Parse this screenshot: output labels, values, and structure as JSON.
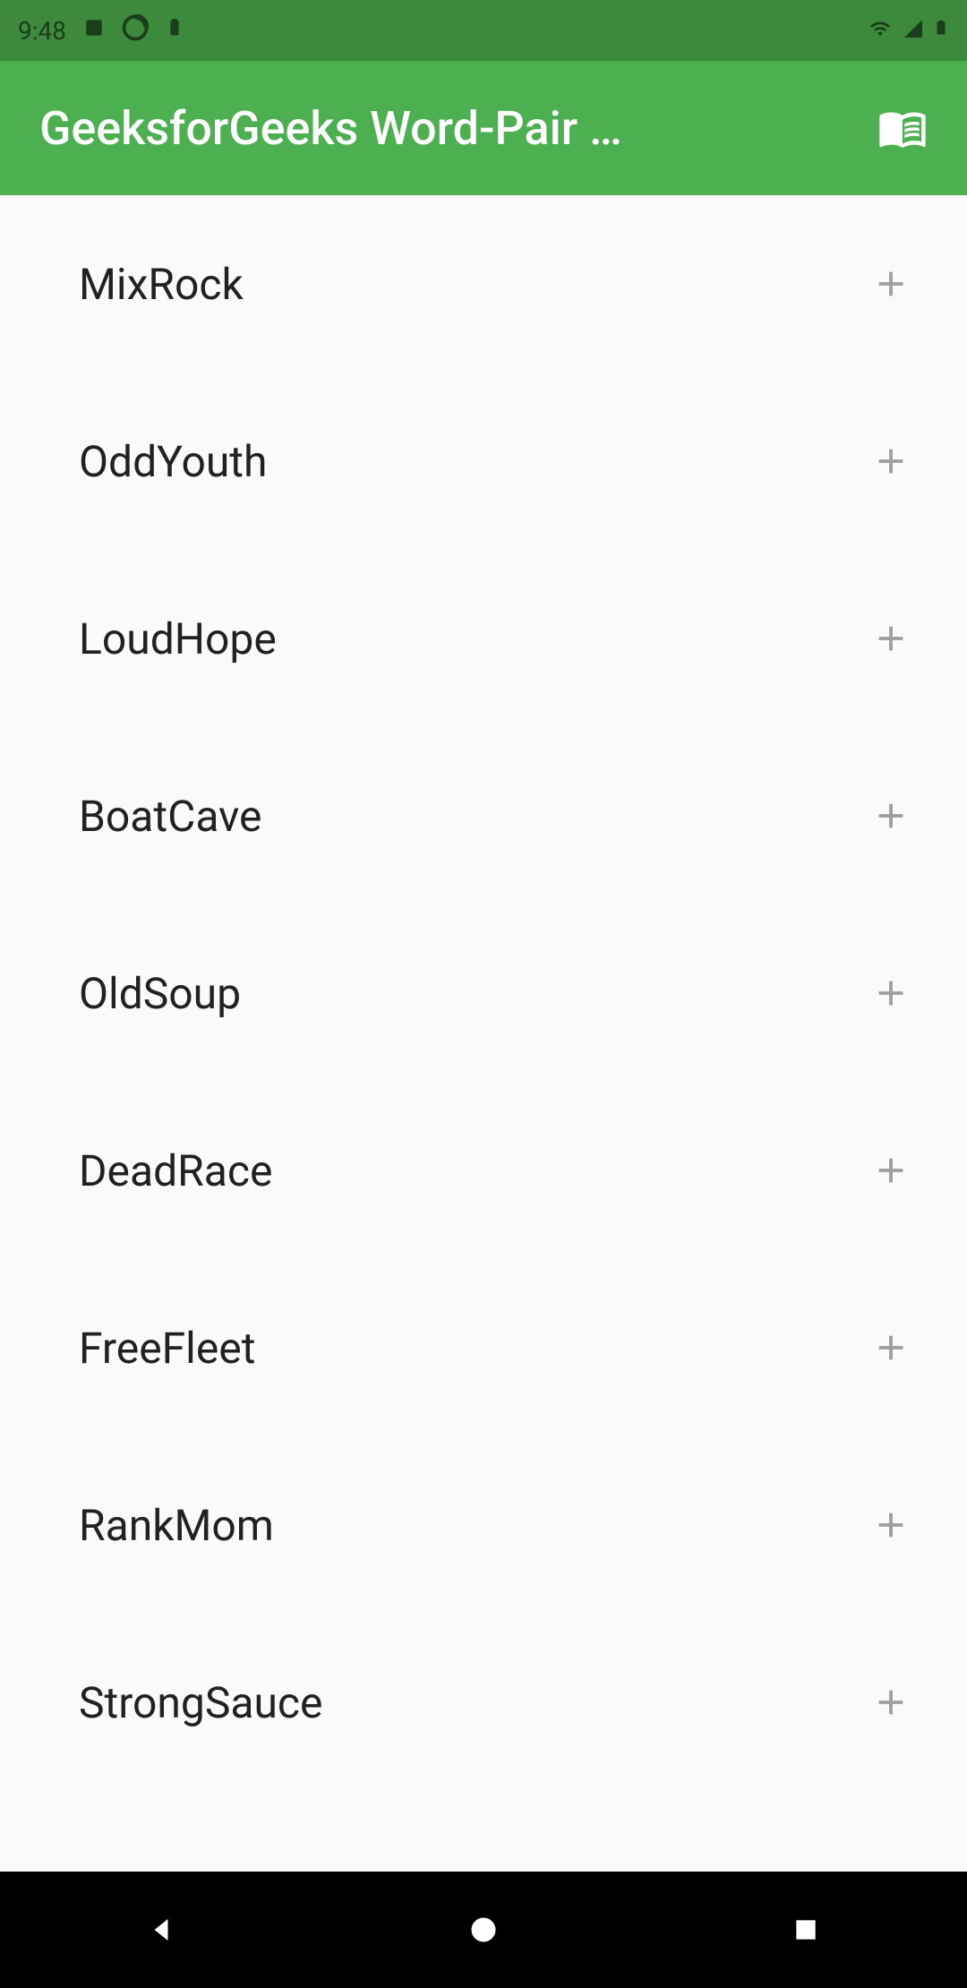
{
  "status": {
    "time": "9:48"
  },
  "appBar": {
    "title": "GeeksforGeeks Word-Pair …"
  },
  "list": {
    "items": [
      {
        "label": "MixRock"
      },
      {
        "label": "OddYouth"
      },
      {
        "label": "LoudHope"
      },
      {
        "label": "BoatCave"
      },
      {
        "label": "OldSoup"
      },
      {
        "label": "DeadRace"
      },
      {
        "label": "FreeFleet"
      },
      {
        "label": "RankMom"
      },
      {
        "label": "StrongSauce"
      }
    ]
  }
}
